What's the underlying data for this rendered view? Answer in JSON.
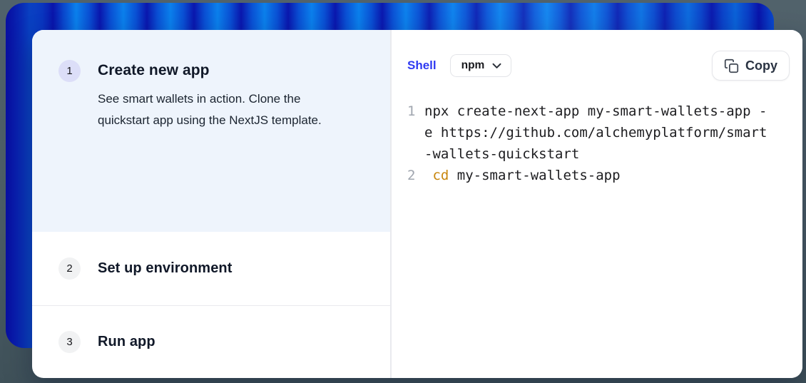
{
  "steps": [
    {
      "number": "1",
      "title": "Create new app",
      "description": "See smart wallets in action. Clone the quickstart app using the NextJS template.",
      "state": "expanded"
    },
    {
      "number": "2",
      "title": "Set up environment",
      "state": "collapsed"
    },
    {
      "number": "3",
      "title": "Run app",
      "state": "collapsed"
    }
  ],
  "code_panel": {
    "language_label": "Shell",
    "package_manager_selected": "npm",
    "copy_label": "Copy",
    "display_lines": [
      {
        "num": "1",
        "prefix": "",
        "text": "npx create-next-app my-smart-wallets-app -"
      },
      {
        "num": "",
        "prefix": "",
        "text": "e https://github.com/alchemyplatform/smart"
      },
      {
        "num": "",
        "prefix": "",
        "text": "-wallets-quickstart"
      },
      {
        "num": "2",
        "prefix": " cd",
        "text": " my-smart-wallets-app"
      }
    ]
  },
  "colors": {
    "accent_blue": "#2f3af2",
    "keyword_orange": "#c8860d",
    "active_step_bg": "#eef4fc",
    "active_badge_bg": "#dcdef8",
    "inactive_badge_bg": "#f1f2f3",
    "backdrop_blue_bright": "#0b80ec",
    "backdrop_blue_dark": "#0a17ae",
    "page_bg_slate": "#4a5b64",
    "line_number_gray": "#a0a6af"
  }
}
